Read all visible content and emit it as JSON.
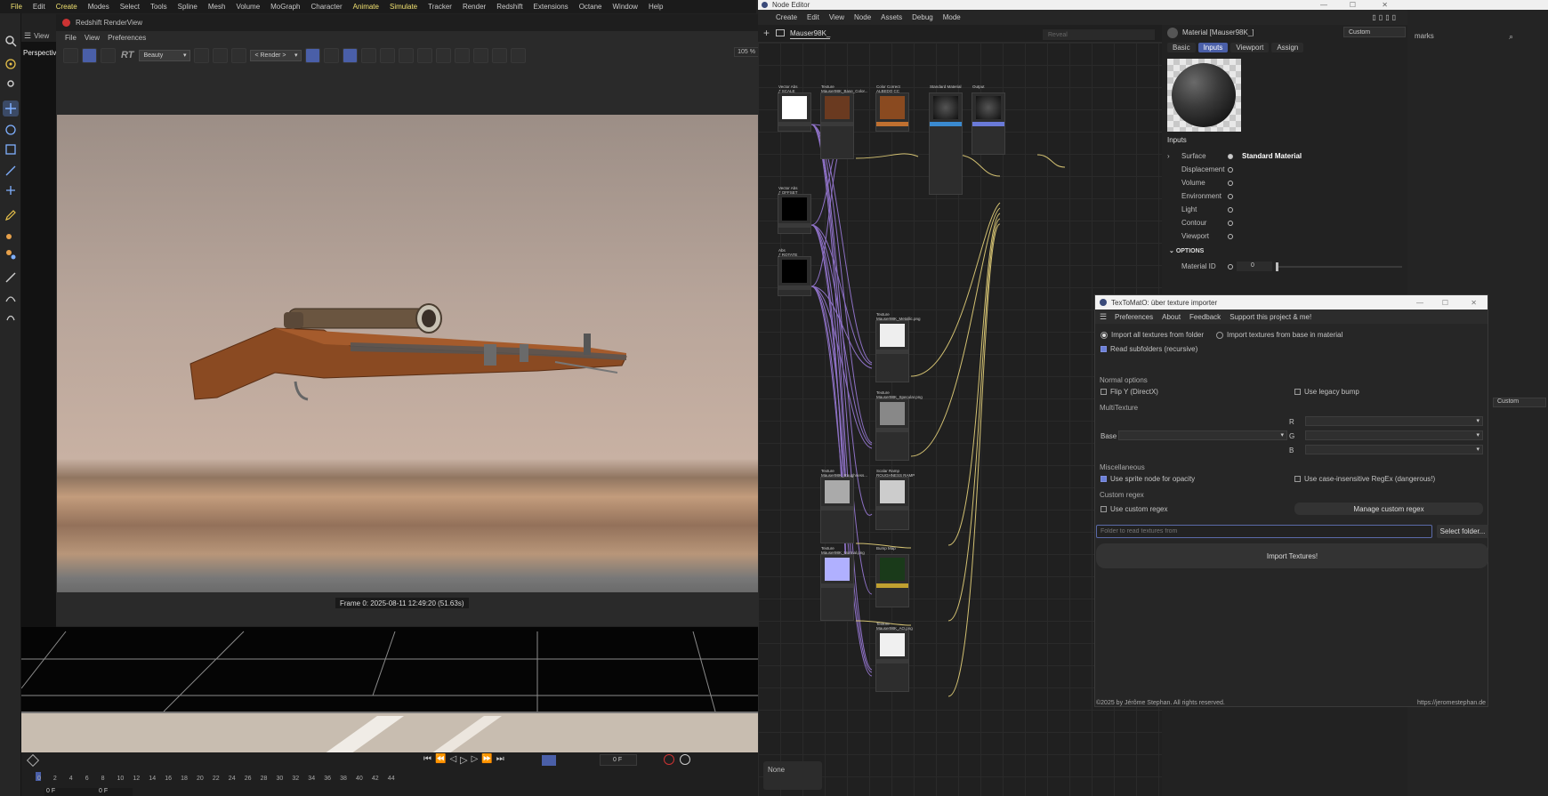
{
  "menubar": {
    "items": [
      "File",
      "Edit",
      "Create",
      "Modes",
      "Select",
      "Tools",
      "Spline",
      "Mesh",
      "Volume",
      "MoGraph",
      "Character",
      "Animate",
      "Simulate",
      "Tracker",
      "Render",
      "Redshift",
      "Extensions",
      "Octane",
      "Window",
      "Help"
    ]
  },
  "renderview": {
    "title": "Redshift RenderView",
    "menu": [
      "File",
      "View",
      "Preferences"
    ],
    "aov_select": "Beauty",
    "render_select": "< Render >",
    "zoom": "105 %",
    "frame_label": "Frame  0:  2025-08-11  12:49:20  (51.63s)",
    "rt_label": "RT"
  },
  "viewport": {
    "view_label": "View",
    "camera_label": "Perspective"
  },
  "timeline": {
    "frame_field": "0 F",
    "start_field": "0 F",
    "end_field": "0 F",
    "ticks": [
      "0",
      "2",
      "4",
      "6",
      "8",
      "10",
      "12",
      "14",
      "16",
      "18",
      "20",
      "22",
      "24",
      "26",
      "28",
      "30",
      "32",
      "34",
      "36",
      "38",
      "40",
      "42",
      "44"
    ]
  },
  "node_editor": {
    "title": "Node Editor",
    "menu": [
      "Create",
      "Edit",
      "View",
      "Node",
      "Assets",
      "Debug",
      "Mode"
    ],
    "tab": "Mauser98K_",
    "reveal_placeholder": "Reveal",
    "none_label": "None",
    "nodes": [
      {
        "id": "n1",
        "title": "Vector Abs\nƒ SCALE"
      },
      {
        "id": "n2",
        "title": "Texture\nMauser98K_Base_Color..."
      },
      {
        "id": "n3",
        "title": "Color Correct\nALBEDO CC"
      },
      {
        "id": "n4",
        "title": "Standard Material"
      },
      {
        "id": "n5",
        "title": "Output"
      },
      {
        "id": "n6",
        "title": "Vector Abs\nƒ OFFSET"
      },
      {
        "id": "n7",
        "title": "Abs\nƒ ROTATE"
      },
      {
        "id": "n8",
        "title": "Texture\nMauser98K_Metallic.png"
      },
      {
        "id": "n9",
        "title": "Texture\nMauser98K_Specular.png"
      },
      {
        "id": "n10",
        "title": "Texture\nMauser98K_Roughness..."
      },
      {
        "id": "n11",
        "title": "Scalar Ramp\nROUGHNESS RAMP"
      },
      {
        "id": "n12",
        "title": "Texture\nMauser98K_Normal.png"
      },
      {
        "id": "n13",
        "title": "Bump Map"
      },
      {
        "id": "n14",
        "title": "Texture\nMauser98K_AO.png"
      }
    ]
  },
  "attributes": {
    "header": "Material [Mauser98K_]",
    "mode_select": "Custom",
    "tabs": [
      "Basic",
      "Inputs",
      "Viewport",
      "Assign"
    ],
    "active_tab": "Inputs",
    "inputs_title": "Inputs",
    "surface_label": "Surface",
    "surface_value": "Standard Material",
    "rows": [
      "Displacement",
      "Volume",
      "Environment",
      "Light",
      "Contour",
      "Viewport"
    ],
    "options_title": "OPTIONS",
    "material_id_label": "Material ID",
    "material_id_value": "0",
    "bookmarks_fragment": "marks",
    "custom2": "Custom"
  },
  "texto": {
    "title": "TexToMatO: über texture importer",
    "menu": [
      "Preferences",
      "About",
      "Feedback",
      "Support this project & me!"
    ],
    "radio_all": "Import all textures from folder",
    "radio_base": "Import textures from base in material",
    "read_sub": "Read subfolders (recursive)",
    "normal_options": "Normal options",
    "flip_y": "Flip Y (DirectX)",
    "legacy_bump": "Use legacy bump",
    "multitexture": "MultiTexture",
    "base_label": "Base",
    "r_label": "R",
    "g_label": "G",
    "b_label": "B",
    "misc": "Miscellaneous",
    "sprite": "Use sprite node for opacity",
    "case_insensitive": "Use case-insensitive RegEx (dangerous!)",
    "custom_regex_title": "Custom regex",
    "use_custom_regex": "Use custom regex",
    "manage_regex": "Manage custom regex",
    "folder_placeholder": "Folder to read textures from",
    "select_folder": "Select folder...",
    "import_button": "Import Textures!",
    "copyright": "©2025 by Jérôme Stephan. All rights reserved.",
    "url": "https://jeromestephan.de"
  },
  "colors": {
    "accent": "#4a5fa8",
    "checkbox_on": "#6b7fd6",
    "wire_purple": "#9a7ad8",
    "wire_yellow": "#e6d27a"
  }
}
